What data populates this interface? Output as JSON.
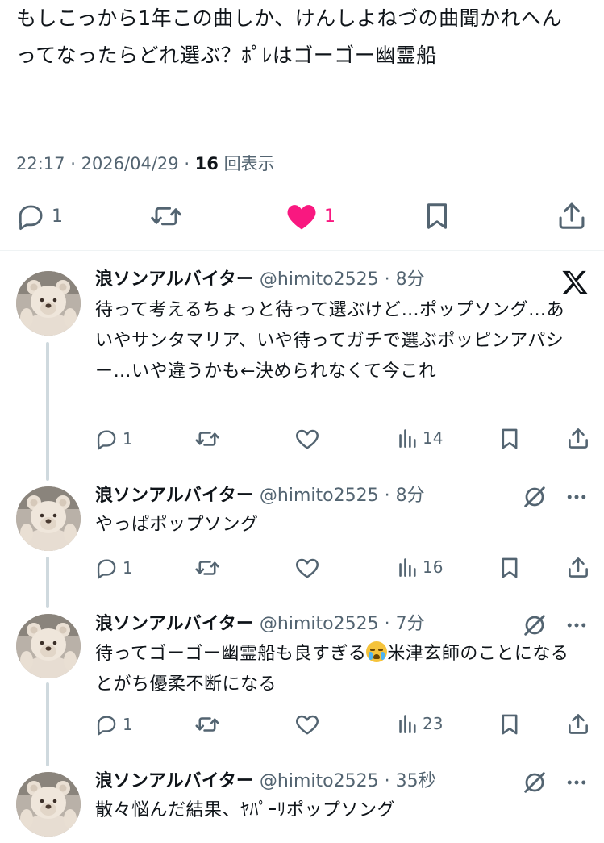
{
  "main_post": {
    "text": "もしこっから1年この曲しか、けんしよねづの曲聞かれへんってなったらどれ選ぶ？ﾎﾟﾚはゴーゴー幽霊船",
    "time": "22:17",
    "date": "2026/04/29",
    "views_count": "16",
    "views_label": "回表示",
    "reply_count": "1",
    "like_count": "1",
    "like_color": "#f91880"
  },
  "replies": [
    {
      "name": "浪ソンアルバイター",
      "handle": "@himito2525",
      "time": "8分",
      "text": "待って考えるちょっと待って選ぶけど…ポップソング…あいやサンタマリア、いや待ってガチで選ぶポッピンアパシー…いや違うかも←決められなくて今これ",
      "reply_count": "1",
      "views": "14",
      "corner_icon": "x-logo-icon"
    },
    {
      "name": "浪ソンアルバイター",
      "handle": "@himito2525",
      "time": "8分",
      "text": "やっぱポップソング",
      "reply_count": "1",
      "views": "16",
      "corner_icon": "grok-icon"
    },
    {
      "name": "浪ソンアルバイター",
      "handle": "@himito2525",
      "time": "7分",
      "text_before_emoji": "待ってゴーゴー幽霊船も良すぎる",
      "emoji": "loudly-crying-face",
      "text_after_emoji": "米津玄師のことになるとがち優柔不断になる",
      "reply_count": "1",
      "views": "23",
      "corner_icon": "grok-icon"
    },
    {
      "name": "浪ソンアルバイター",
      "handle": "@himito2525",
      "time": "35秒",
      "text": "散々悩んだ結果、ﾔﾊﾟｰﾘポップソング",
      "corner_icon": "grok-icon"
    }
  ]
}
